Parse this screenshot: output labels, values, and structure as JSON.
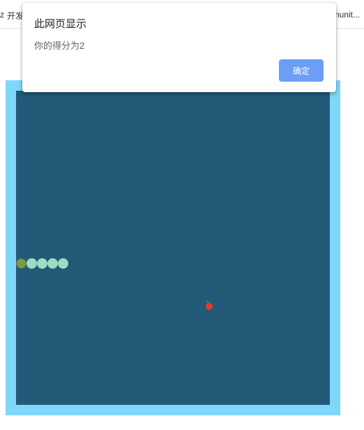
{
  "bookmarks_bar": {
    "left_text": "开发",
    "left_prefix": "z",
    "right_text": "munit..."
  },
  "alert_dialog": {
    "title": "此网页显示",
    "message": "你的得分为2",
    "ok_label": "确定"
  },
  "game": {
    "colors": {
      "frame": "#7fd7fa",
      "field": "#225a78",
      "snake_body": "#9fdcc3",
      "snake_head": "#7a9c4f",
      "food": "#e83a2a"
    },
    "snake_direction": "left",
    "snake_segment_count": 5,
    "food_icon": "apple-icon"
  }
}
